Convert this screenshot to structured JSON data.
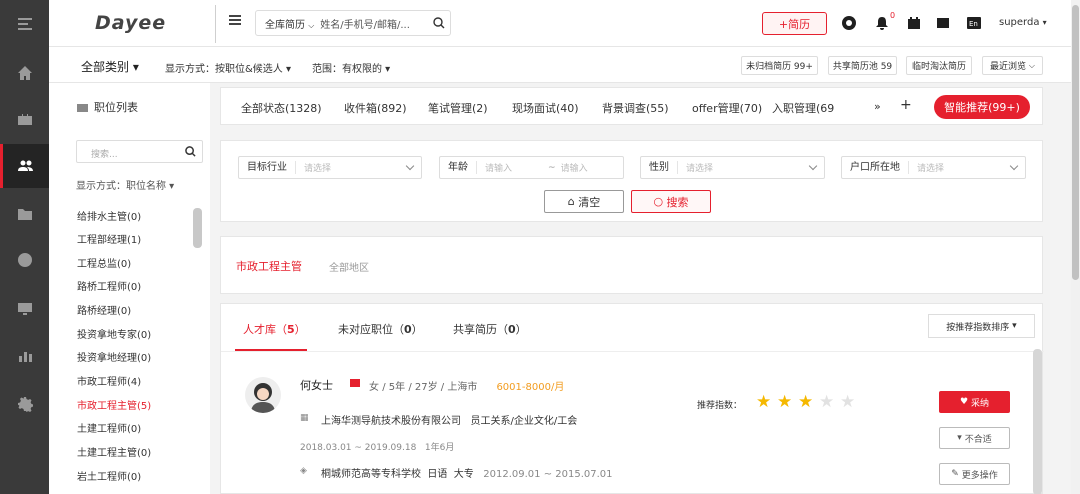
{
  "brand": {
    "logo": "Dayee",
    "accent": "#e5202e"
  },
  "sidebar": {
    "icons": [
      "menu-toggle-icon",
      "home-icon",
      "briefcase-icon",
      "users-icon",
      "folder-icon",
      "globe-icon",
      "monitor-icon",
      "bar-chart-icon",
      "gear-icon"
    ],
    "active": 3
  },
  "header": {
    "search_scope": "全库简历",
    "search_placeholder": "姓名/手机号/邮箱/...",
    "new_resume": "+简历",
    "notification_count": "0",
    "user": "superda"
  },
  "subbar": {
    "category": "全部类别",
    "display_mode": "显示方式：按职位&候选人",
    "scope": "范围：有权限的",
    "quick": [
      "未归档简历 99+",
      "共享简历池 59",
      "临时淘汰简历",
      "最近浏览"
    ]
  },
  "left_panel": {
    "title": "职位列表",
    "search_placeholder": "搜索...",
    "display_mode": "显示方式：职位名称",
    "jobs": [
      "给排水主管(0)",
      "工程部经理(1)",
      "工程总监(0)",
      "路桥工程师(0)",
      "路桥经理(0)",
      "投资拿地专家(0)",
      "投资拿地经理(0)",
      "市政工程师(4)",
      "市政工程主管(5)",
      "土建工程师(0)",
      "土建工程主管(0)",
      "岩土工程师(0)"
    ],
    "selected": 8
  },
  "status_tabs": [
    "全部状态(1328)",
    "收件箱(892)",
    "笔试管理(2)",
    "现场面试(40)",
    "背景调查(55)",
    "offer管理(70)",
    "入职管理(69"
  ],
  "smart_recommend": "智能推荐(99+)",
  "filters": {
    "industry_label": "目标行业",
    "industry_placeholder": "请选择",
    "age_label": "年龄",
    "age_from": "请输入",
    "age_to": "请输入",
    "age_sep": "~",
    "gender_label": "性别",
    "gender_placeholder": "请选择",
    "hukou_label": "户口所在地",
    "hukou_placeholder": "请选择",
    "clear": "清空",
    "search": "搜索"
  },
  "location": {
    "job": "市政工程主管",
    "area": "全部地区"
  },
  "results": {
    "tabs": [
      {
        "label": "人才库（",
        "count": "5",
        "end": "）"
      },
      {
        "label": "未对应职位（",
        "count": "0",
        "end": "）"
      },
      {
        "label": "共享简历（",
        "count": "0",
        "end": "）"
      }
    ],
    "sort": "按推荐指数排序"
  },
  "candidate": {
    "name": "何女士",
    "gender": "女",
    "sep": "/",
    "exp": "5年",
    "age": "27岁",
    "city": "上海市",
    "salary": "6001-8000/月",
    "company": "上海华测导航技术股份有限公司",
    "role": "员工关系/企业文化/工会",
    "period": "2018.03.01 ~ 2019.09.18",
    "duration": "1年6月",
    "school": "桐城师范高等专科学校",
    "major": "日语",
    "degree": "大专",
    "edu_period": "2012.09.01 ~ 2015.07.01",
    "recommend_label": "推荐指数：",
    "stars": 3,
    "max_stars": 5,
    "accept": "采纳",
    "reject": "不合适",
    "more": "更多操作"
  }
}
